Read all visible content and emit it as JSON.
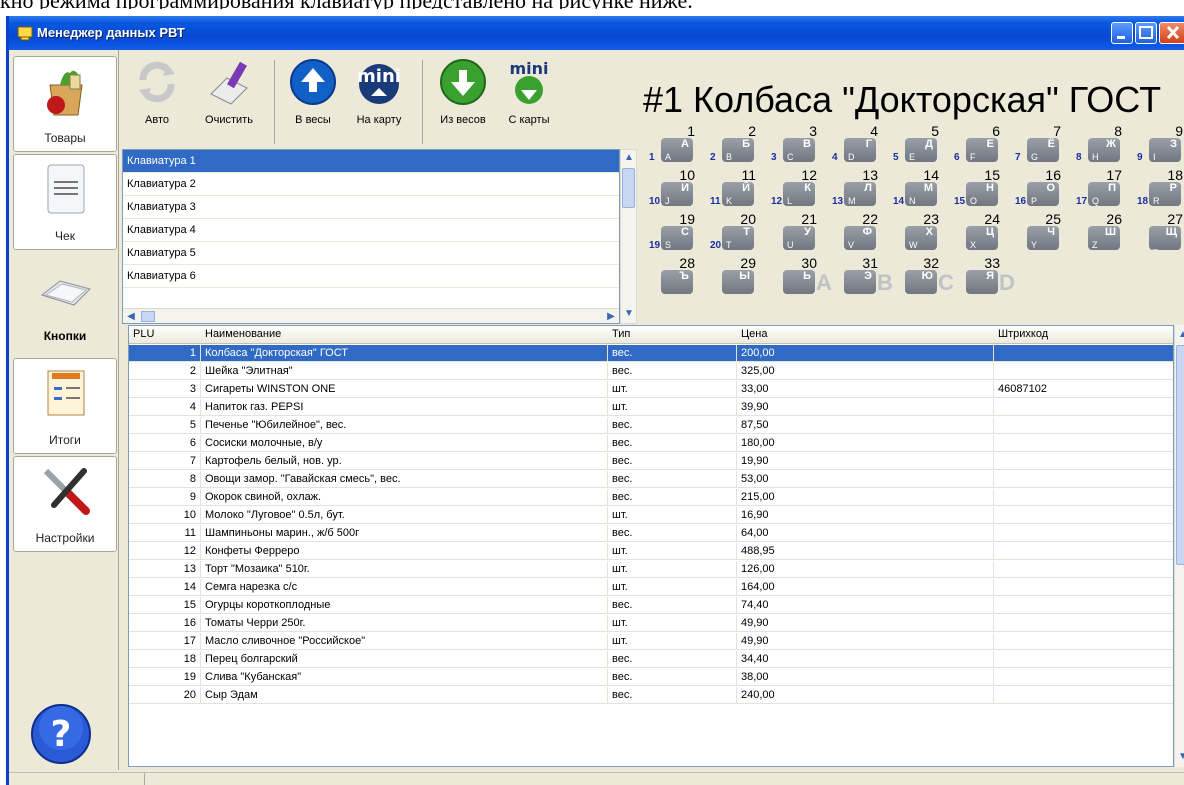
{
  "caption": "кно режима программирования клавиатур представлено на рисунке ниже.",
  "window": {
    "title": "Менеджер данных РВТ"
  },
  "sidebar": {
    "items": [
      {
        "label": "Товары"
      },
      {
        "label": "Чек"
      },
      {
        "label": "Кнопки"
      },
      {
        "label": "Итоги"
      },
      {
        "label": "Настройки"
      }
    ]
  },
  "toolbar": {
    "auto": "Авто",
    "clear": "Очистить",
    "to_scales": "В весы",
    "to_card": "На карту",
    "from_scales": "Из весов",
    "from_card": "С карты"
  },
  "keyboards": [
    "Клавиатура 1",
    "Клавиатура 2",
    "Клавиатура 3",
    "Клавиатура 4",
    "Клавиатура 5",
    "Клавиатура 6"
  ],
  "keyboard_title": "#1 Колбаса \"Докторская\" ГОСТ",
  "keys": {
    "row1": [
      {
        "n": "1",
        "k": "А",
        "s": "A",
        "slot": "1"
      },
      {
        "n": "2",
        "k": "Б",
        "s": "B",
        "slot": "2"
      },
      {
        "n": "3",
        "k": "В",
        "s": "C",
        "slot": "3"
      },
      {
        "n": "4",
        "k": "Г",
        "s": "D",
        "slot": "4"
      },
      {
        "n": "5",
        "k": "Д",
        "s": "E",
        "slot": "5"
      },
      {
        "n": "6",
        "k": "Е",
        "s": "F",
        "slot": "6"
      },
      {
        "n": "7",
        "k": "Ё",
        "s": "G",
        "slot": "7"
      },
      {
        "n": "8",
        "k": "Ж",
        "s": "H",
        "slot": "8"
      },
      {
        "n": "9",
        "k": "З",
        "s": "I",
        "slot": "9"
      }
    ],
    "row2": [
      {
        "n": "10",
        "k": "И",
        "s": "J",
        "slot": "10"
      },
      {
        "n": "11",
        "k": "Й",
        "s": "K",
        "slot": "11"
      },
      {
        "n": "12",
        "k": "К",
        "s": "L",
        "slot": "12"
      },
      {
        "n": "13",
        "k": "Л",
        "s": "M",
        "slot": "13"
      },
      {
        "n": "14",
        "k": "М",
        "s": "N",
        "slot": "14"
      },
      {
        "n": "15",
        "k": "Н",
        "s": "O",
        "slot": "15"
      },
      {
        "n": "16",
        "k": "О",
        "s": "P",
        "slot": "16"
      },
      {
        "n": "17",
        "k": "П",
        "s": "Q",
        "slot": "17"
      },
      {
        "n": "18",
        "k": "Р",
        "s": "R",
        "slot": "18"
      }
    ],
    "row3": [
      {
        "n": "19",
        "k": "С",
        "s": "S",
        "slot": "19"
      },
      {
        "n": "20",
        "k": "Т",
        "s": "T",
        "slot": "20"
      },
      {
        "n": "21",
        "k": "У",
        "s": "U",
        "slot": ""
      },
      {
        "n": "22",
        "k": "Ф",
        "s": "V",
        "slot": ""
      },
      {
        "n": "23",
        "k": "Х",
        "s": "W",
        "slot": ""
      },
      {
        "n": "24",
        "k": "Ц",
        "s": "X",
        "slot": ""
      },
      {
        "n": "25",
        "k": "Ч",
        "s": "Y",
        "slot": ""
      },
      {
        "n": "26",
        "k": "Ш",
        "s": "Z",
        "slot": ""
      },
      {
        "n": "27",
        "k": "Щ",
        "s": "_",
        "slot": ""
      }
    ],
    "row4": [
      {
        "n": "28",
        "k": "Ъ",
        "s": "",
        "slot": ""
      },
      {
        "n": "29",
        "k": "Ы",
        "s": "",
        "slot": ""
      },
      {
        "n": "30",
        "k": "Ь",
        "s": "",
        "slot": "A"
      },
      {
        "n": "31",
        "k": "Э",
        "s": "",
        "slot": "B"
      },
      {
        "n": "32",
        "k": "Ю",
        "s": "",
        "slot": "C"
      },
      {
        "n": "33",
        "k": "Я",
        "s": "",
        "slot": "D"
      }
    ]
  },
  "grid": {
    "headers": {
      "plu": "PLU",
      "name": "Наименование",
      "type": "Тип",
      "price": "Цена",
      "barcode": "Штрихкод"
    },
    "rows": [
      {
        "plu": "1",
        "name": "Колбаса \"Докторская\" ГОСТ",
        "type": "вес.",
        "price": "200,00",
        "barcode": ""
      },
      {
        "plu": "2",
        "name": "Шейка \"Элитная\"",
        "type": "вес.",
        "price": "325,00",
        "barcode": ""
      },
      {
        "plu": "3",
        "name": "Сигареты WINSTON ONE",
        "type": "шт.",
        "price": "33,00",
        "barcode": "46087102"
      },
      {
        "plu": "4",
        "name": "Напиток газ. PEPSI",
        "type": "шт.",
        "price": "39,90",
        "barcode": ""
      },
      {
        "plu": "5",
        "name": "Печенье \"Юбилейное\", вес.",
        "type": "вес.",
        "price": "87,50",
        "barcode": ""
      },
      {
        "plu": "6",
        "name": "Сосиски молочные, в/у",
        "type": "вес.",
        "price": "180,00",
        "barcode": ""
      },
      {
        "plu": "7",
        "name": "Картофель белый, нов. ур.",
        "type": "вес.",
        "price": "19,90",
        "barcode": ""
      },
      {
        "plu": "8",
        "name": "Овощи замор. \"Гавайская смесь\", вес.",
        "type": "вес.",
        "price": "53,00",
        "barcode": ""
      },
      {
        "plu": "9",
        "name": "Окорок свиной, охлаж.",
        "type": "вес.",
        "price": "215,00",
        "barcode": ""
      },
      {
        "plu": "10",
        "name": "Молоко \"Луговое\" 0.5л, бут.",
        "type": "шт.",
        "price": "16,90",
        "barcode": ""
      },
      {
        "plu": "11",
        "name": "Шампиньоны марин., ж/б 500г",
        "type": "вес.",
        "price": "64,00",
        "barcode": ""
      },
      {
        "plu": "12",
        "name": "Конфеты Ферреро",
        "type": "шт.",
        "price": "488,95",
        "barcode": ""
      },
      {
        "plu": "13",
        "name": "Торт \"Мозаика\" 510г.",
        "type": "шт.",
        "price": "126,00",
        "barcode": ""
      },
      {
        "plu": "14",
        "name": "Семга нарезка с/с",
        "type": "шт.",
        "price": "164,00",
        "barcode": ""
      },
      {
        "plu": "15",
        "name": "Огурцы короткоплодные",
        "type": "вес.",
        "price": "74,40",
        "barcode": ""
      },
      {
        "plu": "16",
        "name": "Томаты Черри 250г.",
        "type": "шт.",
        "price": "49,90",
        "barcode": ""
      },
      {
        "plu": "17",
        "name": "Масло сливочное \"Российское\"",
        "type": "шт.",
        "price": "49,90",
        "barcode": ""
      },
      {
        "plu": "18",
        "name": "Перец болгарский",
        "type": "вес.",
        "price": "34,40",
        "barcode": ""
      },
      {
        "plu": "19",
        "name": "Слива \"Кубанская\"",
        "type": "вес.",
        "price": "38,00",
        "barcode": ""
      },
      {
        "plu": "20",
        "name": "Сыр Эдам",
        "type": "вес.",
        "price": "240,00",
        "barcode": ""
      }
    ]
  },
  "colors": {
    "title_bar": "#0649d1",
    "selection": "#316ac5",
    "window_bg": "#ece9d8",
    "key_cap": "#8a9098"
  },
  "icons": [
    "app-icon",
    "products-icon",
    "receipt-icon",
    "keyboard-icon",
    "totals-icon",
    "settings-icon",
    "help-icon",
    "refresh-icon",
    "clear-icon",
    "to-scales-icon",
    "to-card-icon",
    "from-scales-icon",
    "from-card-icon"
  ]
}
